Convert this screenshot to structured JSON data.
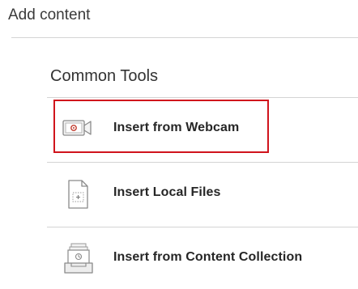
{
  "page": {
    "title": "Add content"
  },
  "section": {
    "title": "Common Tools"
  },
  "tools": [
    {
      "label": "Insert from Webcam",
      "icon": "webcam-icon",
      "highlighted": true
    },
    {
      "label": "Insert Local Files",
      "icon": "local-file-icon",
      "highlighted": false
    },
    {
      "label": "Insert from Content Collection",
      "icon": "content-collection-icon",
      "highlighted": false
    }
  ],
  "colors": {
    "highlight": "#d0141c",
    "divider": "#d4d4d4",
    "icon_stroke": "#8a8a8a",
    "webcam_accent": "#c0392b"
  }
}
